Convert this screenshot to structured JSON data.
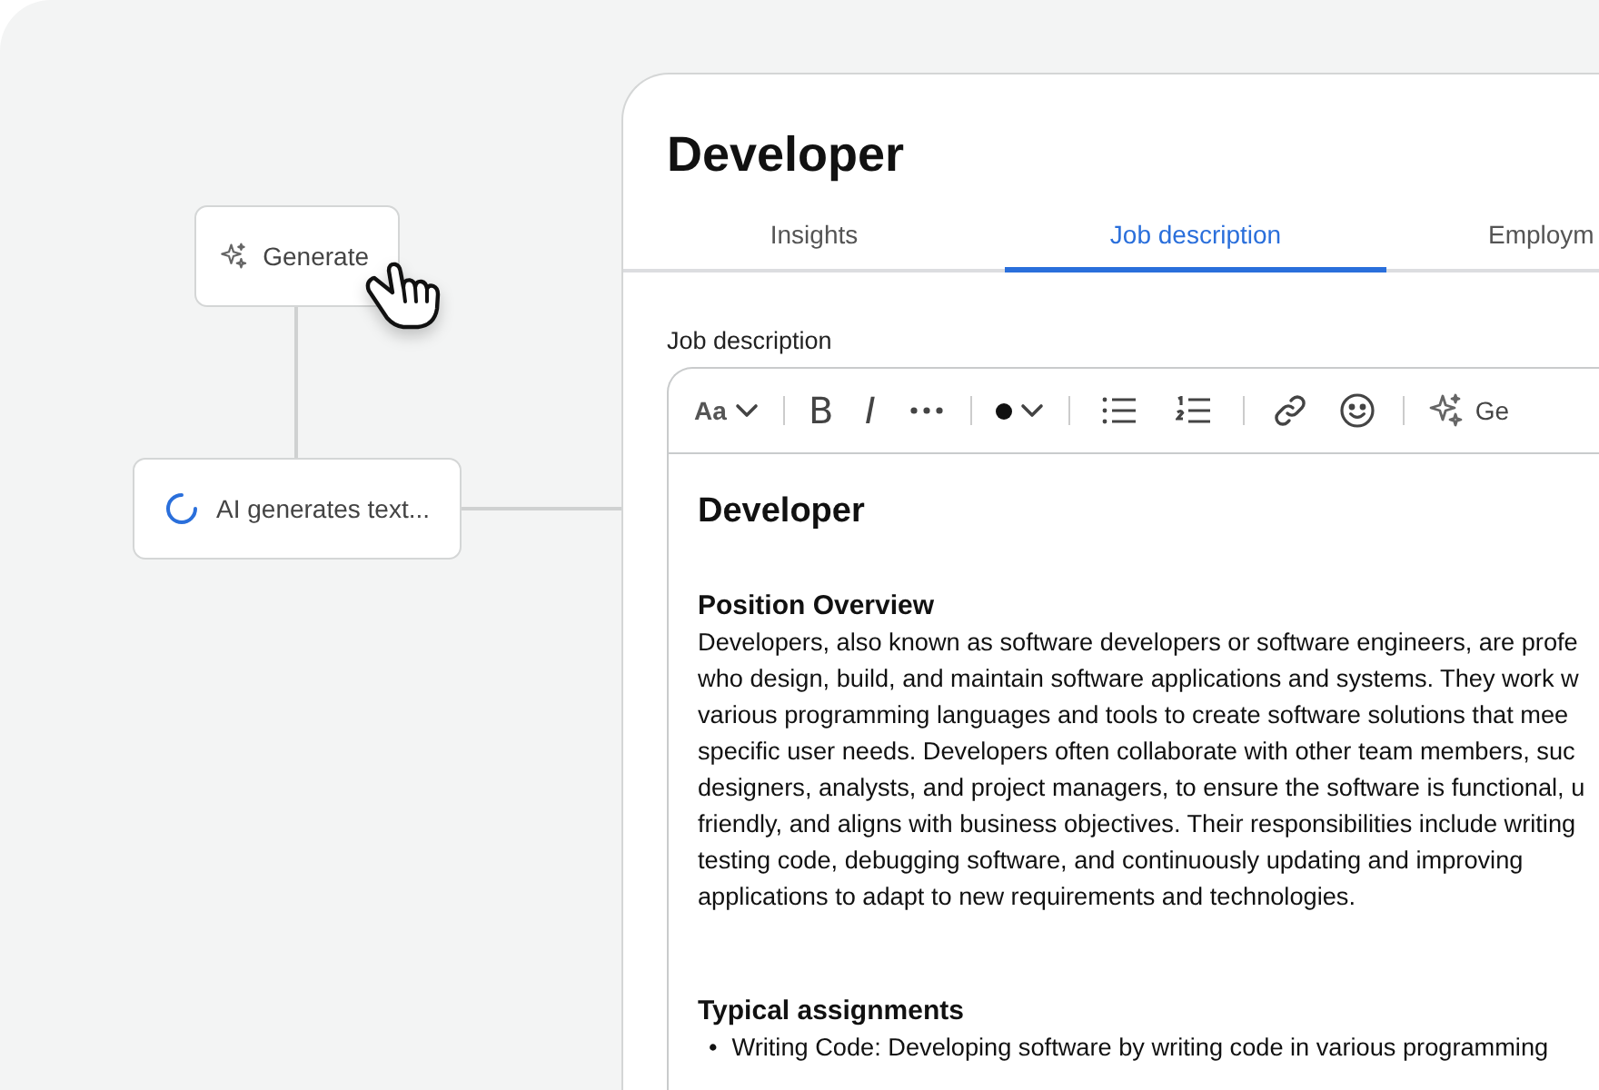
{
  "nodes": [
    {
      "kind": "action",
      "label": "Generate"
    },
    {
      "kind": "loading",
      "label": "AI generates text..."
    }
  ],
  "panel": {
    "title": "Developer",
    "tabs": [
      {
        "label": "Insights",
        "selected": false
      },
      {
        "label": "Job description",
        "selected": true
      },
      {
        "label": "Employm",
        "selected": false
      }
    ],
    "field_label": "Job description",
    "toolbar": [
      {
        "kind": "text-dropdown",
        "label": "Aa"
      },
      {
        "kind": "separator"
      },
      {
        "kind": "bold",
        "label": "B"
      },
      {
        "kind": "italic",
        "label": "I"
      },
      {
        "kind": "more"
      },
      {
        "kind": "separator"
      },
      {
        "kind": "color-dropdown"
      },
      {
        "kind": "separator"
      },
      {
        "kind": "bullets"
      },
      {
        "kind": "numbered"
      },
      {
        "kind": "separator"
      },
      {
        "kind": "link"
      },
      {
        "kind": "emoji"
      },
      {
        "kind": "separator"
      },
      {
        "kind": "ai",
        "label": "Ge"
      }
    ],
    "document": [
      {
        "kind": "title",
        "text": "Developer"
      },
      {
        "kind": "heading",
        "text": "Position Overview"
      },
      {
        "kind": "paragraph",
        "lines": [
          "Developers, also known as software developers or software engineers, are profe",
          "who design, build, and maintain software applications and systems. They work w",
          "various programming languages and tools to create software solutions that mee",
          "specific user needs. Developers often collaborate with other team members, suc",
          "designers, analysts, and project managers, to ensure the software is functional, u",
          "friendly, and aligns with business objectives. Their responsibilities include writing",
          "testing code, debugging software, and continuously updating and improving",
          "applications to adapt to new requirements and technologies."
        ]
      },
      {
        "kind": "heading",
        "text": "Typical assignments"
      },
      {
        "kind": "bullets",
        "marker": "•",
        "items": [
          "Writing Code: Developing software by writing code in various programming"
        ]
      }
    ]
  }
}
